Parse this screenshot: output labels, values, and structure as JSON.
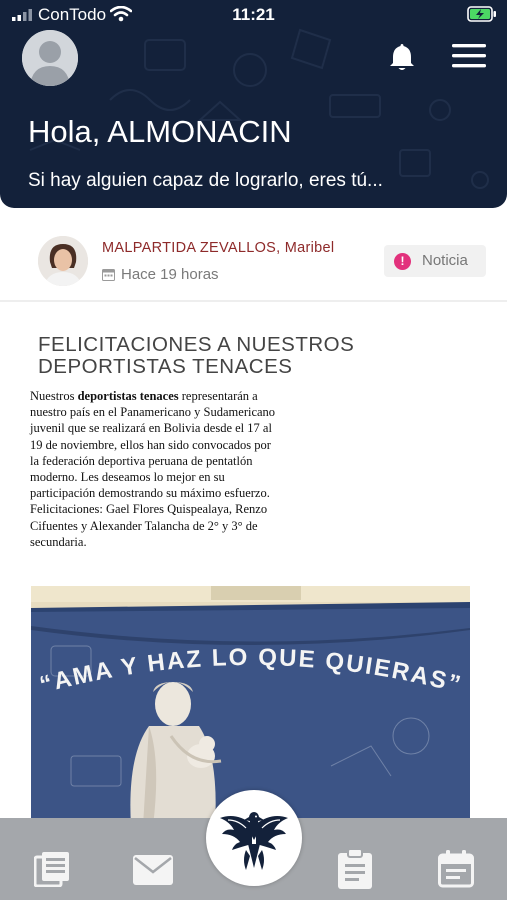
{
  "status_bar": {
    "carrier": "ConTodo",
    "time": "11:21"
  },
  "header": {
    "greeting": "Hola, ALMONACIN",
    "tagline": "Si hay alguien capaz de lograrlo, eres tú..."
  },
  "post": {
    "author_surname": "MALPARTIDA ZEVALLOS",
    "author_given": ", Maribel",
    "time_ago": "Hace 19 horas",
    "badge_symbol": "!",
    "badge_label": "Noticia",
    "title": "FELICITACIONES A NUESTROS DEPORTISTAS TENACES",
    "body_before": "Nuestros ",
    "body_bold": "deportistas tenaces",
    "body_after": " representarán a nuestro país en el Panamericano y Sudamericano juvenil que se realizará en Bolivia desde el 17 al 19 de noviembre, ellos han sido convocados por la federación deportiva peruana de pentatlón moderno. Les deseamos lo mejor en su participación demostrando su máximo esfuerzo. Felicitaciones: Gael Flores Quispealaya, Renzo Cifuentes y Alexander Talancha de 2° y 3° de secundaria.",
    "photo_text": "“AMA Y HAZ LO QUE QUIERAS”"
  },
  "tabbar": {
    "items": [
      "news-icon",
      "mail-icon",
      "logo-icon",
      "clipboard-icon",
      "calendar-icon"
    ]
  },
  "colors": {
    "header_bg": "#13213a",
    "author_color": "#8e2a2a",
    "badge_accent": "#e2317c",
    "tabbar_bg": "#a4a7ab",
    "icon_color": "#f4f4f4"
  }
}
